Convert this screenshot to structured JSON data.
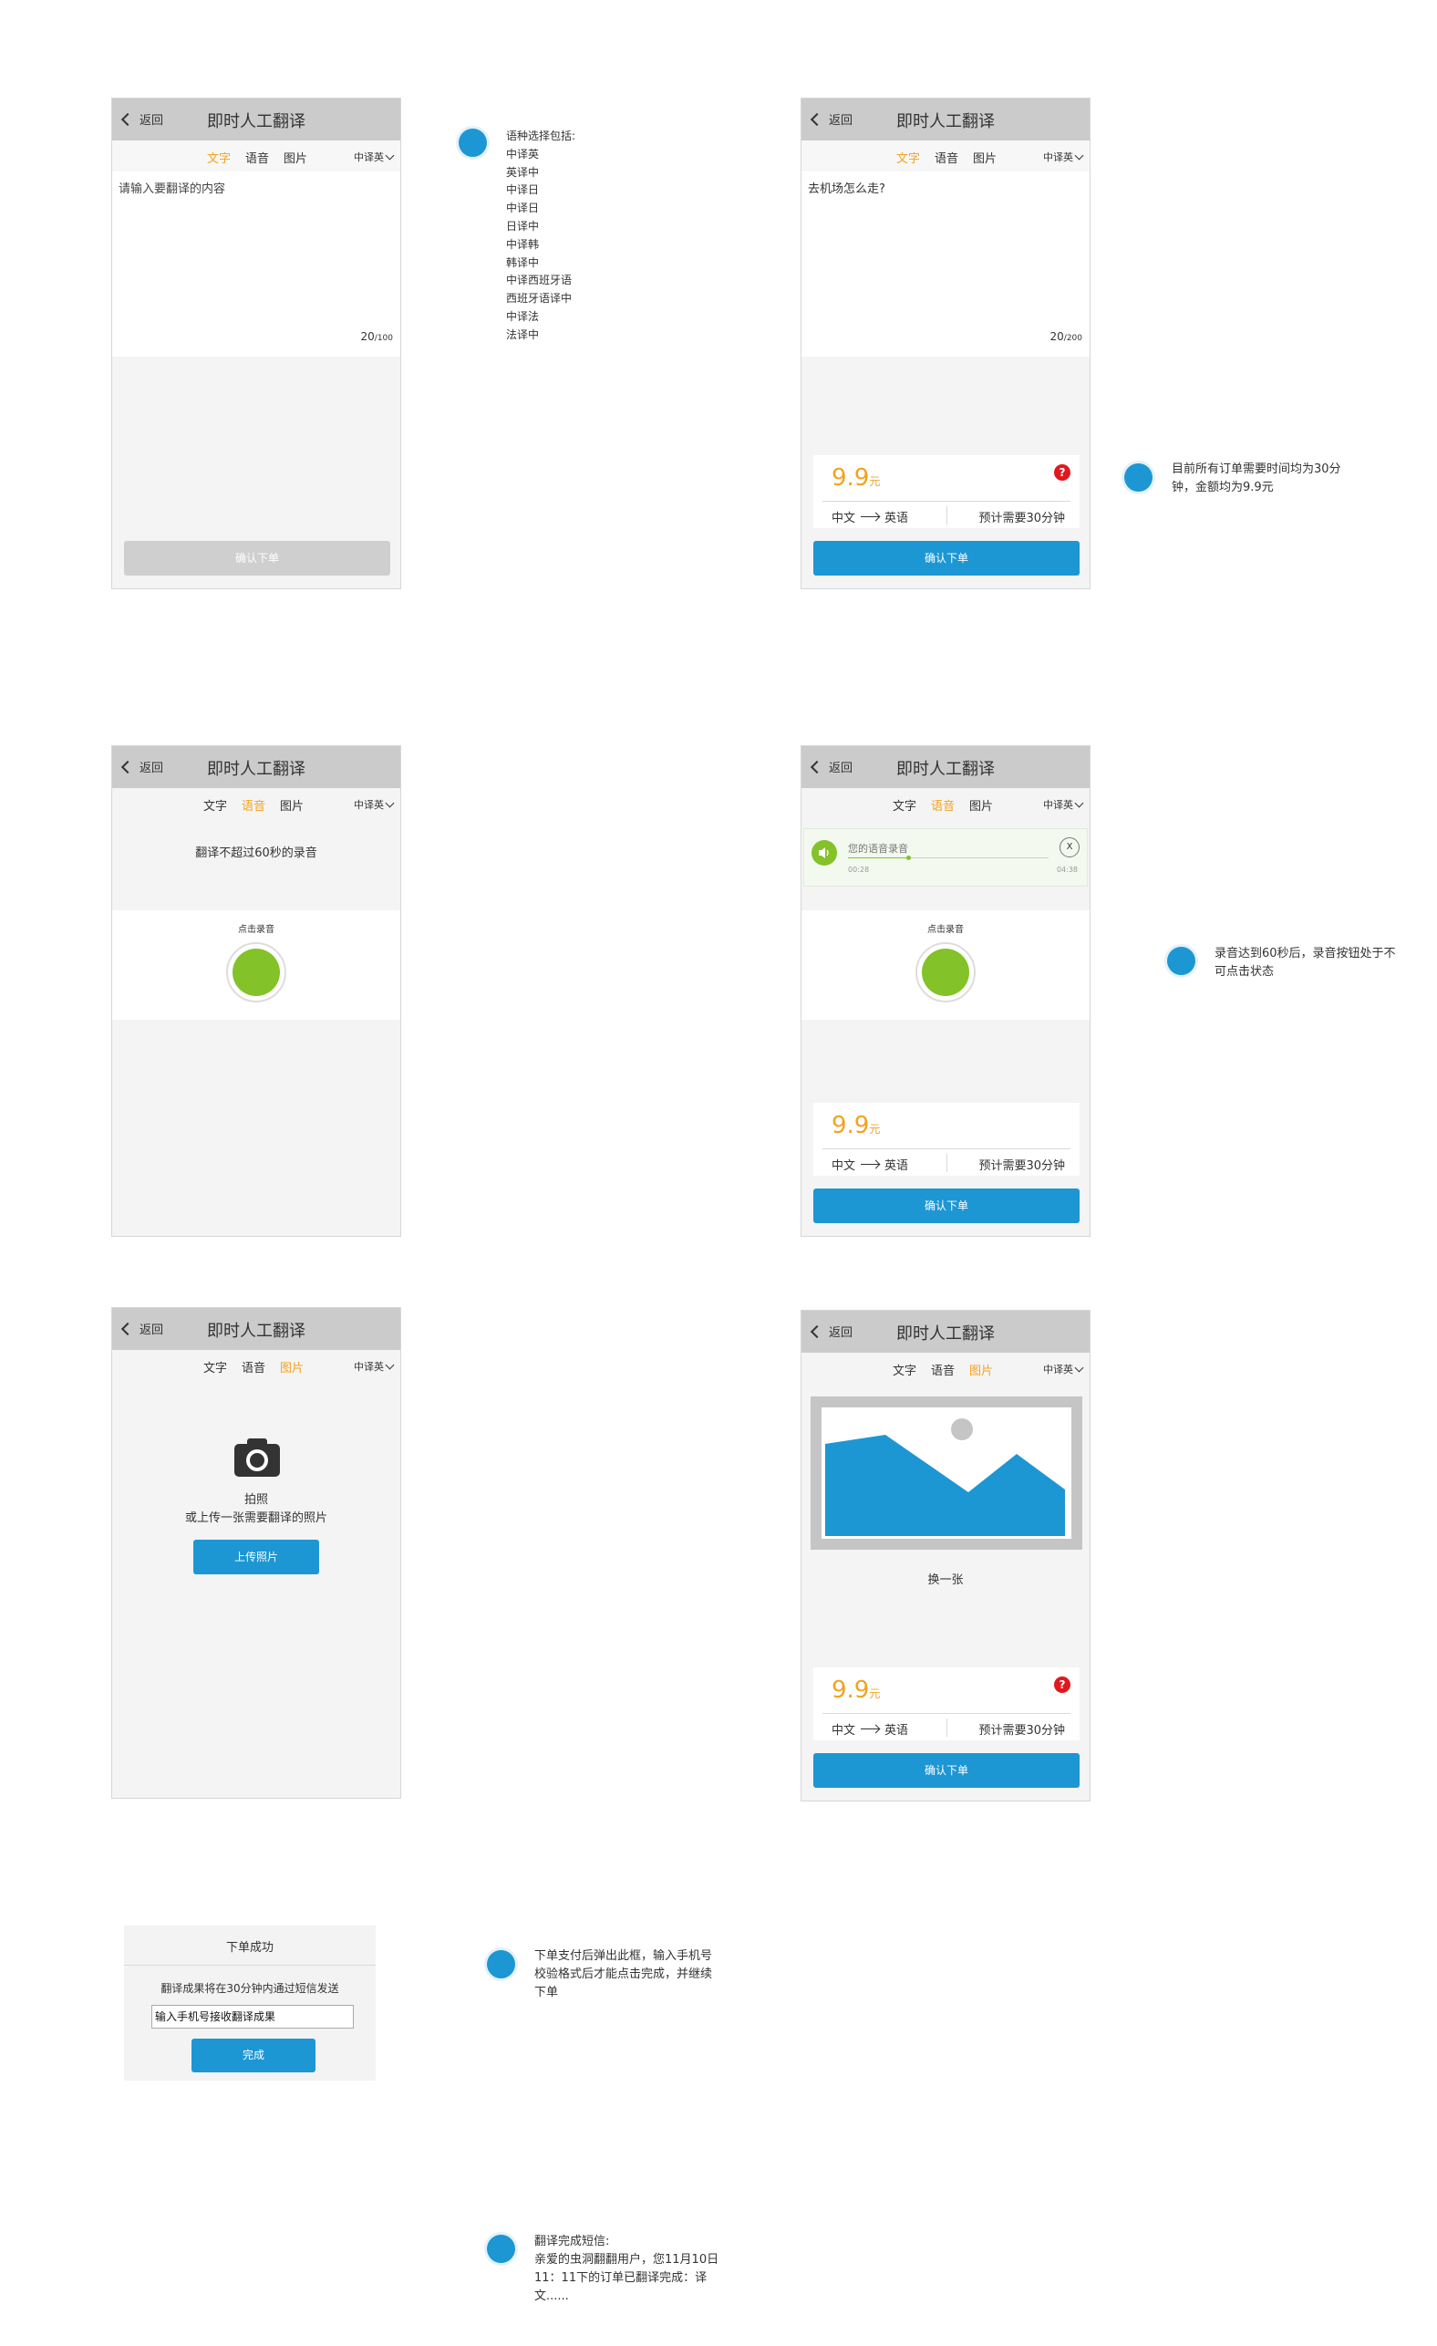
{
  "nav": {
    "back_label": "返回",
    "title": "即时人工翻译"
  },
  "tabs": {
    "text": "文字",
    "voice": "语音",
    "photo": "图片",
    "lang": "中译英"
  },
  "screen1": {
    "placeholder": "请输入要翻译的内容",
    "count": "20",
    "max": "/100",
    "confirm": "确认下单"
  },
  "note_lang": "语种选择包括:\n中译英\n英译中\n中译日\n中译日\n日译中\n中译韩\n韩译中\n中译西班牙语\n西班牙语译中\n中译法\n法译中",
  "screen2": {
    "content": "去机场怎么走?",
    "count": "20",
    "max": "/200"
  },
  "order": {
    "price": "9.9",
    "unit": "元",
    "from": "中文",
    "to": "英语",
    "eta": "预计需要30分钟",
    "confirm": "确认下单",
    "help": "?"
  },
  "note_price": "目前所有订单需要时间均为30分\n钟，金额均为9.9元",
  "screen3": {
    "hint": "翻译不超过60秒的录音",
    "tap": "点击录音"
  },
  "screen4": {
    "recording": "您的语音录音",
    "time_start": "00:28",
    "time_end": "04:38",
    "close": "X",
    "tap": "点击录音"
  },
  "note_record": "录音达到60秒后，录音按钮处于不\n可点击状态",
  "screen5": {
    "take_photo": "拍照",
    "upload_hint": "或上传一张需要翻译的照片",
    "upload_btn": "上传照片"
  },
  "screen6": {
    "change": "换一张"
  },
  "dialog": {
    "title": "下单成功",
    "msg": "翻译成果将在30分钟内通过短信发送",
    "input": "输入手机号接收翻译成果",
    "done": "完成"
  },
  "note_dialog": "下单支付后弹出此框，输入手机号\n校验格式后才能点击完成，并继续\n下单",
  "note_sms": "翻译完成短信:\n亲爱的虫洞翻翻用户，您11月10日\n11：11下的订单已翻译完成：译\n文......",
  "colors": {
    "accent": "#1d96d4",
    "active_tab": "#f3a21f",
    "price": "#f3a21f",
    "record": "#83c228",
    "help": "#e0191e"
  }
}
